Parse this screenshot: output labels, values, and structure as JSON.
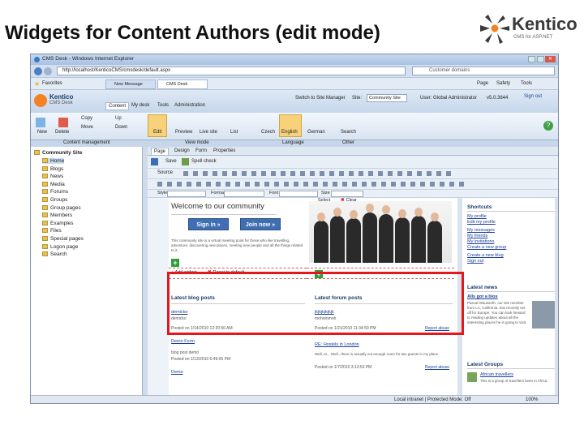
{
  "slide": {
    "title": "Widgets for Content Authors (edit mode)"
  },
  "logo": {
    "word": "Kentico",
    "sub": "CMS for ASP.NET"
  },
  "browser": {
    "window_title": "CMS Desk - Windows Internet Explorer",
    "address": "http://localhost/KenticoCMS/cmsdesk/default.aspx",
    "search": "Customer domains",
    "favorites": "Favorites",
    "tabs": [
      "New Message",
      "CMS Desk"
    ],
    "menu": [
      "Page",
      "Safety",
      "Tools"
    ],
    "status_zone": "Local intranet | Protected Mode: Off",
    "zoom": "100%"
  },
  "cms": {
    "logo_top": "Kentico",
    "logo_bottom": "CMS Desk",
    "main_tabs": [
      "Content",
      "My desk",
      "Tools",
      "Administration"
    ],
    "switch": "Switch to Site Manager",
    "site_label": "Site:",
    "site_value": "Community Site",
    "user": "User: Global Administrator",
    "version": "v5.0.3644",
    "signout": "Sign out",
    "ribbon": [
      {
        "label": "New"
      },
      {
        "label": "Delete"
      },
      {
        "label": "Copy"
      },
      {
        "label": "Move"
      },
      {
        "label": "Up"
      },
      {
        "label": "Down"
      },
      {
        "label": "Edit"
      },
      {
        "label": "Preview"
      },
      {
        "label": "Live site"
      },
      {
        "label": "List"
      },
      {
        "label": "Czech"
      },
      {
        "label": "English"
      },
      {
        "label": "German"
      },
      {
        "label": "Search"
      }
    ],
    "ribbon_groups": [
      "Content management",
      "View mode",
      "Language",
      "Other"
    ]
  },
  "tree": {
    "root": "Community Site",
    "items": [
      "Home",
      "Blogs",
      "News",
      "Media",
      "Forums",
      "Groups",
      "Group pages",
      "Members",
      "Examples",
      "Files",
      "Special pages",
      "Logon page",
      "Search"
    ]
  },
  "editor": {
    "tabs": [
      "Page",
      "Design",
      "Form",
      "Properties"
    ],
    "save": "Save",
    "spellcheck": "Spell check",
    "source": "Source",
    "style": "Style",
    "format": "Format",
    "font": "Font",
    "size": "Size"
  },
  "page": {
    "welcome": "Welcome to our community",
    "sign_in": "Sign in »",
    "join_now": "Join now »",
    "intro": "This community site is a virtual meeting point for those who like travelling, adventure, discovering new places, meeting new people and all the things related to it.",
    "select": "Select",
    "clear": "Clear",
    "add_widget": "Add widget",
    "reset": "Reset to default",
    "latest_blog_posts": "Latest blog posts",
    "latest_forum_posts": "Latest forum posts",
    "blog": [
      {
        "title": "demicko",
        "meta": "Posted on 1/14/2010 12:20:50 AM",
        "text": "demicko"
      },
      {
        "title": "Demo Form",
        "meta": "Posted on 1/13/2010 6:49:05 PM",
        "text": "blog post demo"
      },
      {
        "title": "Demo",
        "meta": "",
        "text": ""
      }
    ],
    "forum": [
      {
        "title": "jkjkjkjkjkjk",
        "meta": "Posted on 1/21/2010 11:34:50 PM",
        "report": "Report abuse",
        "text": "mohommoh"
      },
      {
        "title": "RE: Hostels in London",
        "meta": "Posted on 1/7/2010 3:13:53 PM",
        "report": "Report abuse",
        "text": "Well, er... Well...there is actually not enough room for two guests in my place"
      }
    ],
    "shortcuts_title": "Shortcuts",
    "shortcuts": [
      "My profile",
      "Edit my profile",
      "My messages",
      "My friends",
      "My invitations",
      "Create a new group",
      "Create a new blog",
      "Sign out"
    ],
    "news_title": "Latest news",
    "news_item": "Alls got a bios",
    "news_text": "Pascal Wauwerth, our site member from LA, California, has recently set off for Europe. You can look forward to reading updates about all the interesting places he is going to visit.",
    "groups_title": "Latest Groups",
    "group_item": "African travellers",
    "group_text": "This is a group of travellers keen in Africa."
  }
}
